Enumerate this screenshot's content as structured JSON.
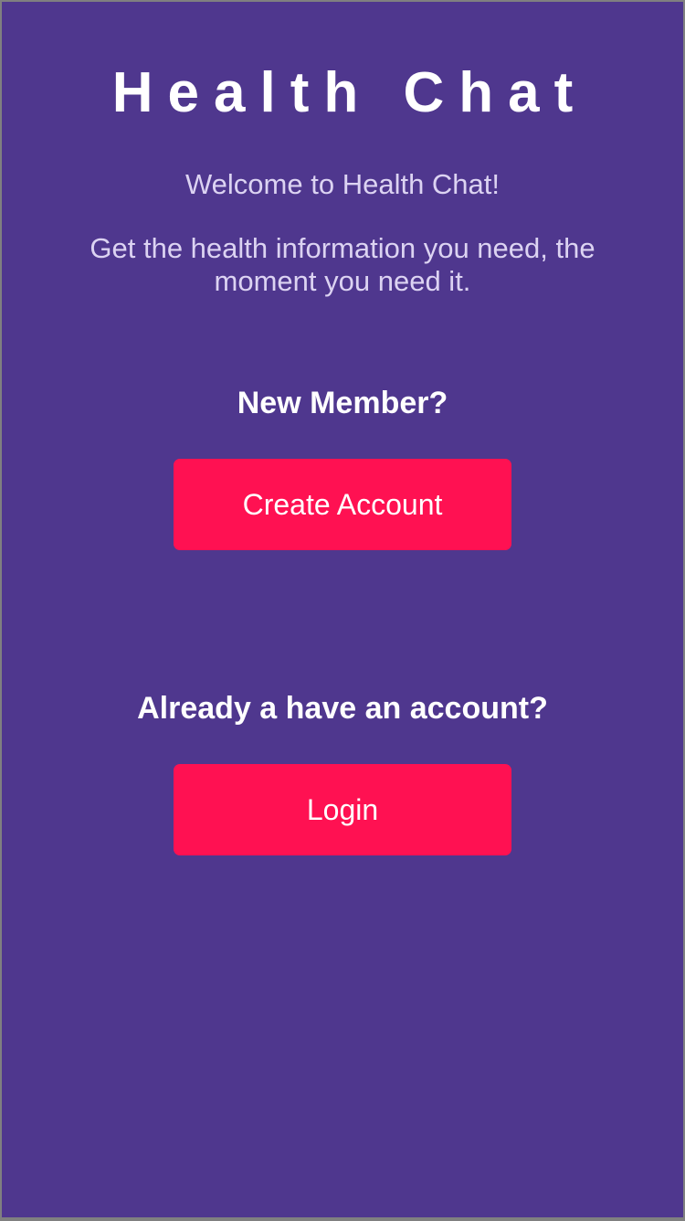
{
  "app": {
    "title": "Health Chat",
    "welcome": "Welcome to Health Chat!",
    "tagline": "Get the health information you need, the moment you need it."
  },
  "signup": {
    "prompt": "New Member?",
    "button_label": "Create Account"
  },
  "signin": {
    "prompt": "Already a have an account?",
    "button_label": "Login"
  },
  "colors": {
    "background": "#4f378e",
    "button": "#ff1152",
    "heading_text": "#ffffff",
    "body_text": "#dcd3f2"
  }
}
